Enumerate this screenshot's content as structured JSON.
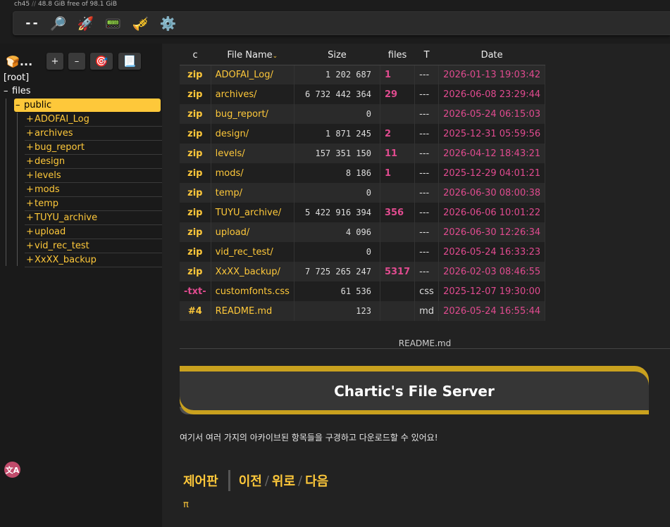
{
  "disk": {
    "host": "ch45",
    "sep": "//",
    "info": "48.8 GiB free of 98.1 GiB"
  },
  "toolbar": {
    "items": [
      "--",
      "🔎",
      "🚀",
      "📟",
      "🎺",
      "⚙️"
    ]
  },
  "tree_toolbar": {
    "bread": "🍞...",
    "plus": "+",
    "minus": "–",
    "target": "🎯",
    "doc": "📃"
  },
  "tree": {
    "root": "[root]",
    "files": "files",
    "files_toggle": "–",
    "public": "public",
    "public_toggle": "–",
    "item_toggle": "+",
    "items": [
      "ADOFAI_Log",
      "archives",
      "bug_report",
      "design",
      "levels",
      "mods",
      "temp",
      "TUYU_archive",
      "upload",
      "vid_rec_test",
      "XxXX_backup"
    ]
  },
  "lang_button": "文A",
  "table": {
    "headers": {
      "c": "c",
      "name": "File Name",
      "size": "Size",
      "files": "files",
      "t": "T",
      "date": "Date"
    },
    "sort_arrow": "⌄",
    "rows": [
      {
        "ext": "zip",
        "name": "ADOFAI_Log/",
        "size": "1 202 687",
        "files": "1",
        "t": "---",
        "date": "2026-01-13 19:03:42"
      },
      {
        "ext": "zip",
        "name": "archives/",
        "size": "6 732 442 364",
        "files": "29",
        "t": "---",
        "date": "2026-06-08 23:29:44"
      },
      {
        "ext": "zip",
        "name": "bug_report/",
        "size": "0",
        "files": "",
        "t": "---",
        "date": "2026-05-24 06:15:03"
      },
      {
        "ext": "zip",
        "name": "design/",
        "size": "1 871 245",
        "files": "2",
        "t": "---",
        "date": "2025-12-31 05:59:56"
      },
      {
        "ext": "zip",
        "name": "levels/",
        "size": "157 351 150",
        "files": "11",
        "t": "---",
        "date": "2026-04-12 18:43:21"
      },
      {
        "ext": "zip",
        "name": "mods/",
        "size": "8 186",
        "files": "1",
        "t": "---",
        "date": "2025-12-29 04:01:21"
      },
      {
        "ext": "zip",
        "name": "temp/",
        "size": "0",
        "files": "",
        "t": "---",
        "date": "2026-06-30 08:00:38"
      },
      {
        "ext": "zip",
        "name": "TUYU_archive/",
        "size": "5 422 916 394",
        "files": "356",
        "t": "---",
        "date": "2026-06-06 10:01:22"
      },
      {
        "ext": "zip",
        "name": "upload/",
        "size": "4 096",
        "files": "",
        "t": "---",
        "date": "2026-06-30 12:26:34"
      },
      {
        "ext": "zip",
        "name": "vid_rec_test/",
        "size": "0",
        "files": "",
        "t": "---",
        "date": "2026-05-24 16:33:23"
      },
      {
        "ext": "zip",
        "name": "XxXX_backup/",
        "size": "7 725 265 247",
        "files": "5317",
        "t": "---",
        "date": "2026-02-03 08:46:55"
      },
      {
        "ext": "-txt-",
        "name": "customfonts.css",
        "size": "61 536",
        "files": "",
        "t": "css",
        "date": "2025-12-07 19:30:00"
      },
      {
        "ext": "#4",
        "name": "README.md",
        "size": "123",
        "files": "",
        "t": "md",
        "date": "2026-05-24 16:55:44"
      }
    ]
  },
  "readme": {
    "label": "README.md",
    "title": "Chartic's File Server",
    "intro": "여기서 여러 가지의 아카이브된 항목들을 구경하고 다운로드할 수 있어요!",
    "nav": {
      "control": "제어판",
      "prev": "이전",
      "up": "위로",
      "next": "다음",
      "slash": "/"
    },
    "pi": "π"
  },
  "colors": {
    "accent": "#fec83a",
    "pink": "#e04b8f",
    "bg": "#222222",
    "sidebar": "#1a1a1a"
  }
}
